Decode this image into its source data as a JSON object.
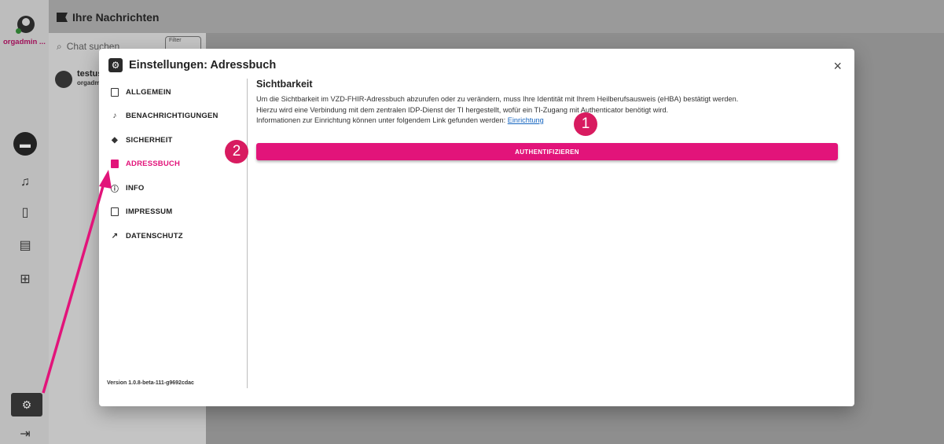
{
  "app": {
    "username": "orgadmin ...",
    "messages_title": "Ihre Nachrichten",
    "search_placeholder": "Chat suchen",
    "filter_label": "Filter",
    "chat_item_name": "testus",
    "chat_item_sub": "orgadm"
  },
  "dialog": {
    "title": "Einstellungen: Adressbuch",
    "close_icon": "×",
    "nav": [
      {
        "label": "ALLGEMEIN",
        "icon": "general-icon"
      },
      {
        "label": "BENACHRICHTIGUNGEN",
        "icon": "bell-icon"
      },
      {
        "label": "SICHERHEIT",
        "icon": "shield-icon"
      },
      {
        "label": "ADRESSBUCH",
        "icon": "contacts-icon",
        "active": true
      },
      {
        "label": "INFO",
        "icon": "info-icon"
      },
      {
        "label": "IMPRESSUM",
        "icon": "document-icon"
      },
      {
        "label": "DATENSCHUTZ",
        "icon": "external-link-icon"
      }
    ],
    "version": "Version 1.0.8-beta-111-g9692cdac",
    "section_title": "Sichtbarkeit",
    "text_line1": "Um die Sichtbarkeit im VZD-FHIR-Adressbuch abzurufen oder zu verändern, muss Ihre Identität mit Ihrem Heilberufsausweis (eHBA) bestätigt werden.",
    "text_line2": "Hierzu wird eine Verbindung mit dem zentralen IDP-Dienst der TI hergestellt, wofür ein TI-Zugang mit Authenticator benötigt wird.",
    "text_line3_prefix": "Informationen zur Einrichtung können unter folgendem Link gefunden werden: ",
    "link_label": "Einrichtung",
    "auth_button": "AUTHENTIFIZIEREN"
  },
  "annotations": {
    "badge1": "1",
    "badge2": "2"
  },
  "colors": {
    "accent": "#e2147a",
    "annotation": "#d81b60",
    "link": "#1565c0"
  }
}
